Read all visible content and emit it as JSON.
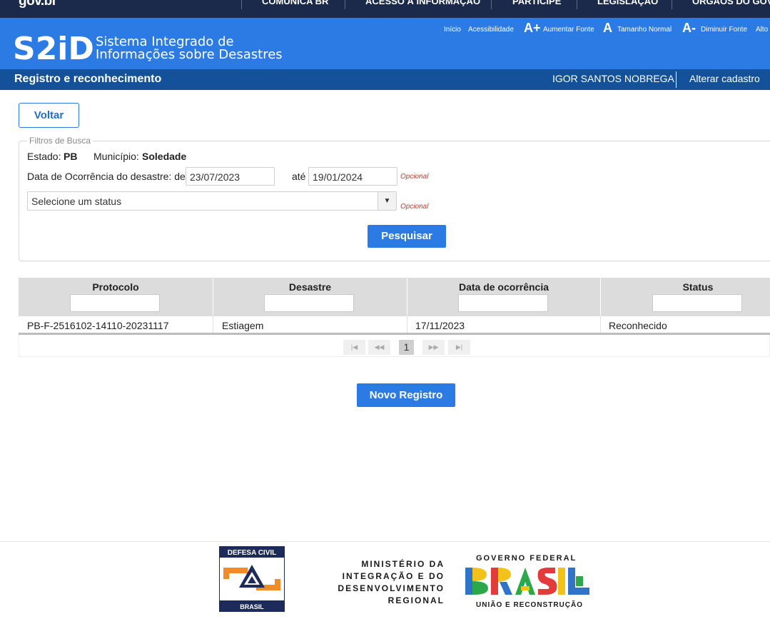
{
  "gov_bar": {
    "logo": "gov.br",
    "nav": [
      "COMUNICA BR",
      "ACESSO À INFORMAÇÃO",
      "PARTICIPE",
      "LEGISLAÇÃO",
      "ÓRGÃOS DO GOVERNO"
    ]
  },
  "header": {
    "brand": "S2iD",
    "subtitle_line1": "Sistema Integrado de",
    "subtitle_line2": "Informações sobre Desastres",
    "accessibility": {
      "inicio": "Início",
      "acessibilidade": "Acessibilidade",
      "aumentar_symbol": "A+",
      "aumentar": "Aumentar Fonte",
      "normal_symbol": "A",
      "normal": "Tamanho Normal",
      "diminuir_symbol": "A-",
      "diminuir": "Diminuir Fonte",
      "alto": "Alto Contraste"
    }
  },
  "subbar": {
    "page_title": "Registro e reconhecimento",
    "user_name": "IGOR SANTOS NOBREGA",
    "alterar_cadastro": "Alterar cadastro"
  },
  "actions": {
    "voltar": "Voltar",
    "pesquisar": "Pesquisar",
    "novo_registro": "Novo Registro"
  },
  "filters": {
    "legend": "Filtros de Busca",
    "estado_label": "Estado:",
    "estado_value": "PB",
    "municipio_label": "Município:",
    "municipio_value": "Soledade",
    "data_label": "Data de Ocorrência do desastre: de",
    "data_de": "23/07/2023",
    "ate_label": "até",
    "data_ate": "19/01/2024",
    "opcional": "Opcional",
    "status_placeholder": "Selecione um status"
  },
  "table": {
    "columns": [
      "Protocolo",
      "Desastre",
      "Data de ocorrência",
      "Status"
    ],
    "rows": [
      [
        "PB-F-2516102-14110-20231117",
        "Estiagem",
        "17/11/2023",
        "Reconhecido"
      ]
    ],
    "pagination": {
      "first": "|◀",
      "prev": "◀◀",
      "current_page": "1",
      "next": "▶▶",
      "last": "▶|"
    }
  },
  "footer": {
    "defesa_civil_top": "DEFESA CIVIL",
    "defesa_civil_bottom": "BRASIL",
    "ministerio_line1": "MINISTÉRIO DA",
    "ministerio_line2": "INTEGRAÇÃO E DO",
    "ministerio_line3": "DESENVOLVIMENTO",
    "ministerio_line4": "REGIONAL",
    "governo_federal": "GOVERNO FEDERAL",
    "brasil_logo": "BRASIL",
    "uniao": "UNIÃO E RECONSTRUÇÃO"
  }
}
